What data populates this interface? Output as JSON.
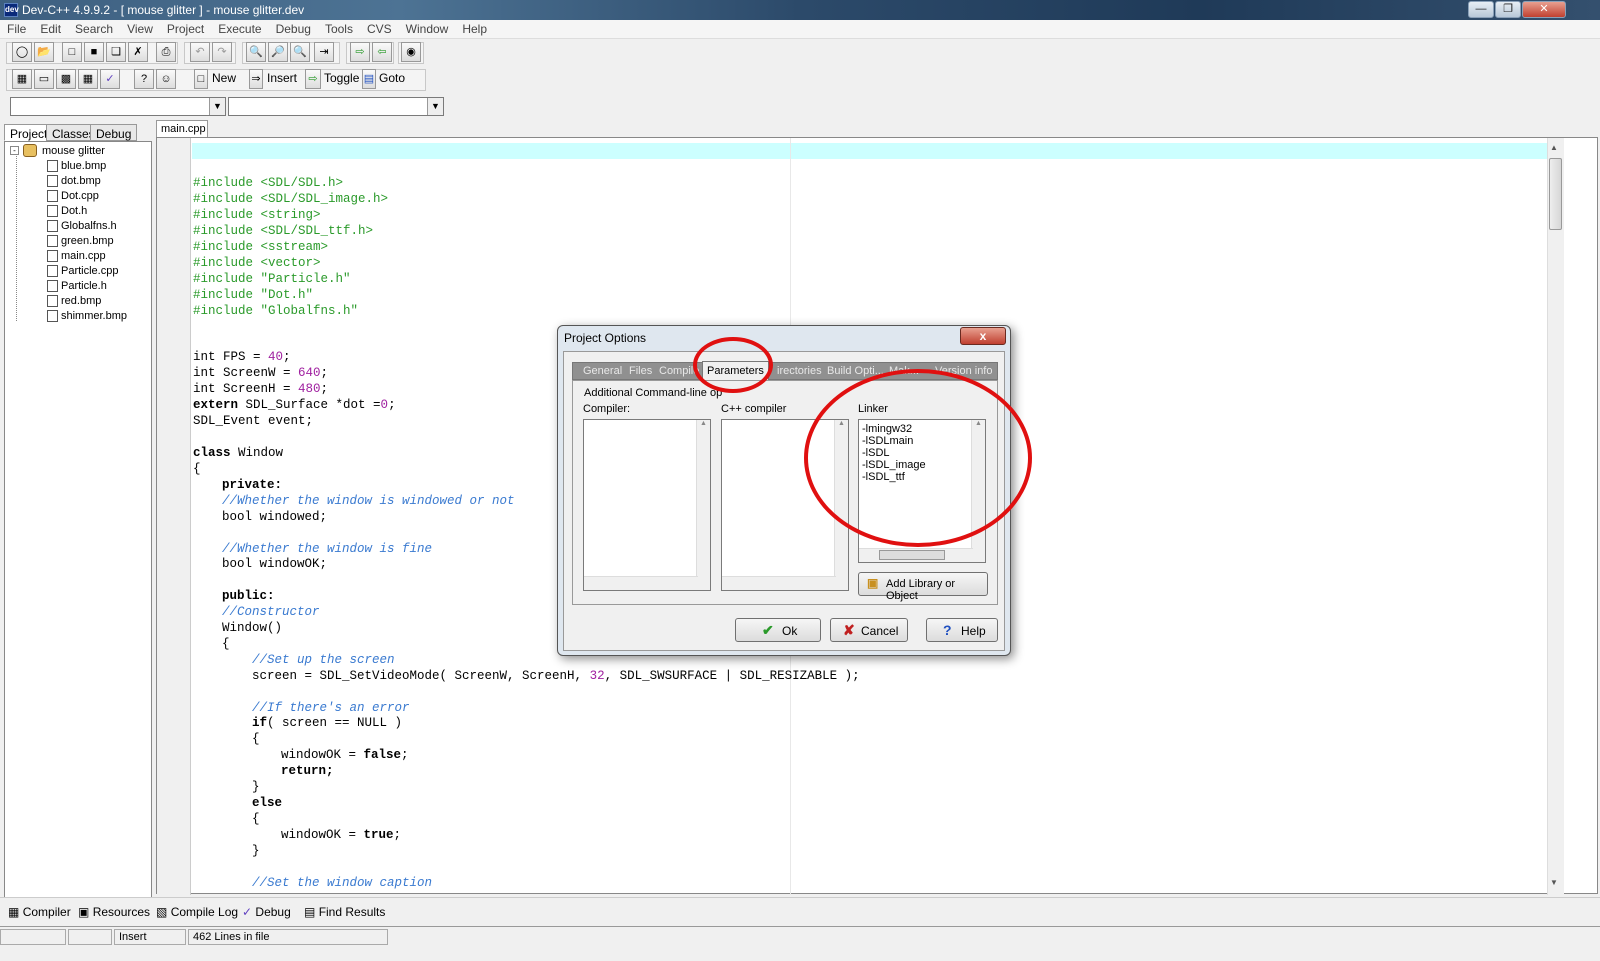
{
  "window": {
    "app_icon": "dev",
    "title": "Dev-C++ 4.9.9.2  -  [ mouse glitter ]  -  mouse glitter.dev"
  },
  "menu": [
    "File",
    "Edit",
    "Search",
    "View",
    "Project",
    "Execute",
    "Debug",
    "Tools",
    "CVS",
    "Window",
    "Help"
  ],
  "toolbar2": {
    "new": "New",
    "insert": "Insert",
    "toggle": "Toggle",
    "goto": "Goto"
  },
  "left_tabs": [
    "Project",
    "Classes",
    "Debug"
  ],
  "tree": {
    "root": "mouse glitter",
    "items": [
      "blue.bmp",
      "dot.bmp",
      "Dot.cpp",
      "Dot.h",
      "Globalfns.h",
      "green.bmp",
      "main.cpp",
      "Particle.cpp",
      "Particle.h",
      "red.bmp",
      "shimmer.bmp"
    ]
  },
  "editor_tab": "main.cpp",
  "code": {
    "includes": [
      "#include <SDL/SDL.h>",
      "#include <SDL/SDL_image.h>",
      "#include <string>",
      "#include <SDL/SDL_ttf.h>",
      "#include <sstream>",
      "#include <vector>",
      "#include \"Particle.h\"",
      "#include \"Dot.h\"",
      "#include \"Globalfns.h\""
    ],
    "fps_pre": "int FPS = ",
    "fps_val": "40",
    "sw_pre": "int ScreenW = ",
    "sw_val": "640",
    "sh_pre": "int ScreenH = ",
    "sh_val": "480",
    "ext_kw": "extern",
    "ext_rest": " SDL_Surface *dot =",
    "ext_val": "0",
    "ext_end": ";",
    "event": "SDL_Event event;",
    "class_kw": "class",
    "class_rest": " Window",
    "brace_open": "{",
    "private": "private:",
    "c1": "//Whether the window is windowed or not",
    "windowed": "bool windowed;",
    "c2": "//Whether the window is fine",
    "windowok": "bool windowOK;",
    "public": "public:",
    "c3": "//Constructor",
    "ctor": "Window()",
    "c4": "//Set up the screen",
    "setvideo_pre": "screen = SDL_SetVideoMode( ScreenW, ScreenH, ",
    "setvideo_num": "32",
    "setvideo_post": ", SDL_SWSURFACE | SDL_RESIZABLE );",
    "c5": "//If there's an error",
    "if_kw": "if",
    "if_rest": "( screen == NULL )",
    "wf_pre": "windowOK = ",
    "wf_val": "false",
    "semi": ";",
    "ret": "return;",
    "close_brace": "}",
    "else": "else",
    "wt_val": "true",
    "c6": "//Set the window caption"
  },
  "bottom_tabs": [
    "Compiler",
    "Resources",
    "Compile Log",
    "Debug",
    "Find Results"
  ],
  "status": {
    "mode": "Insert",
    "lines": "462 Lines in file"
  },
  "dialog": {
    "title": "Project Options",
    "close": "x",
    "tabs": [
      "General",
      "Files",
      "Compiler",
      "Parameters",
      "Directories",
      "Build Options",
      "Makefile",
      "Version info"
    ],
    "tabs_visible": [
      "General",
      "Files",
      "Compile",
      "Parameters",
      "irectories",
      "Build Opti...",
      "Mak...",
      "Version info"
    ],
    "heading": "Additional Command-line options:",
    "heading_visible": "Additional Command-line op",
    "compiler_label": "Compiler:",
    "cpp_label": "C++ compiler",
    "linker_label": "Linker",
    "linker_items": [
      "-lmingw32",
      "-lSDLmain",
      "-lSDL",
      "-lSDL_image",
      "-lSDL_ttf"
    ],
    "add_lib": "Add Library or Object",
    "ok": "Ok",
    "cancel": "Cancel",
    "help": "Help"
  },
  "colors": {
    "highlight_circle": "#e01010",
    "current_line": "#ccffff",
    "preprocessor": "#2a9a2a",
    "comment": "#3a7ad0",
    "number": "#a020a0"
  }
}
